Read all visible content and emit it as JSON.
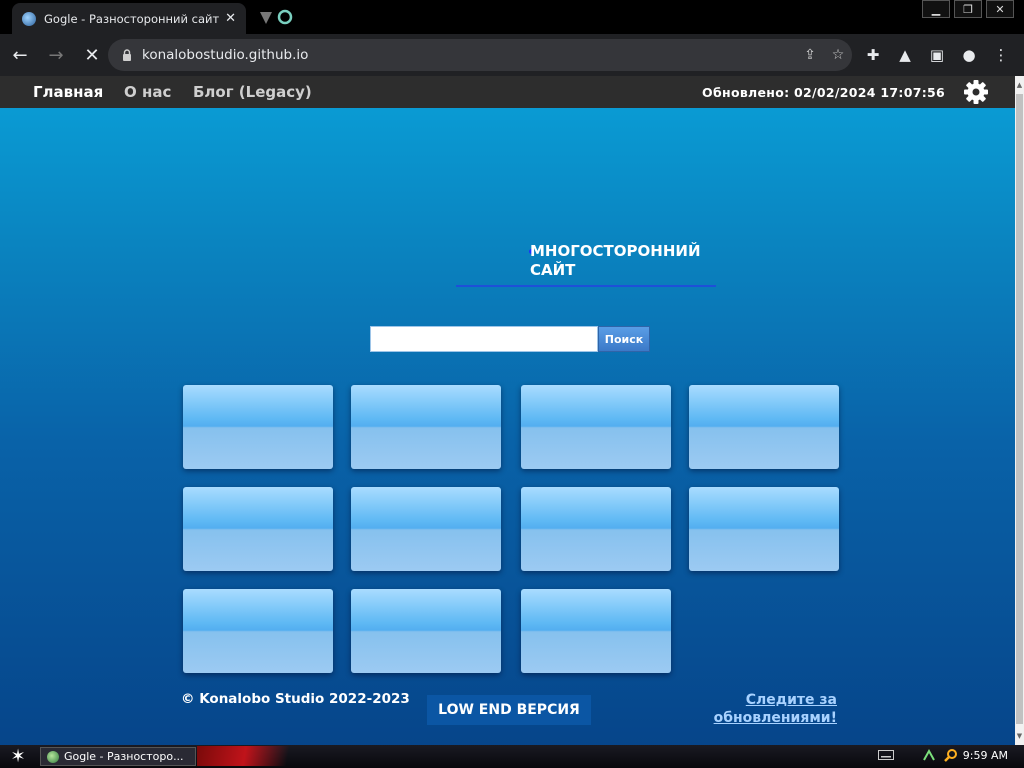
{
  "browser": {
    "tab_title": "Gogle - Разносторонний сайт!",
    "url": "konalobostudio.github.io"
  },
  "site": {
    "nav": [
      "Главная",
      "О нас",
      "Блог (Legacy)"
    ],
    "updated": "Обновлено: 02/02/2024 17:07:56",
    "logo_text": "МНОГОСТОРОННИЙ САЙТ",
    "search_button": "Поиск",
    "search_value": "",
    "tiles_count": 11,
    "copyright": "© Konalobo Studio 2022-2023",
    "lowend_button": "LOW END ВЕРСИЯ",
    "follow_link": "Следите за обновлениями!"
  },
  "taskbar": {
    "task_title": "Gogle - Разносторо...",
    "clock": "9:59 AM"
  }
}
